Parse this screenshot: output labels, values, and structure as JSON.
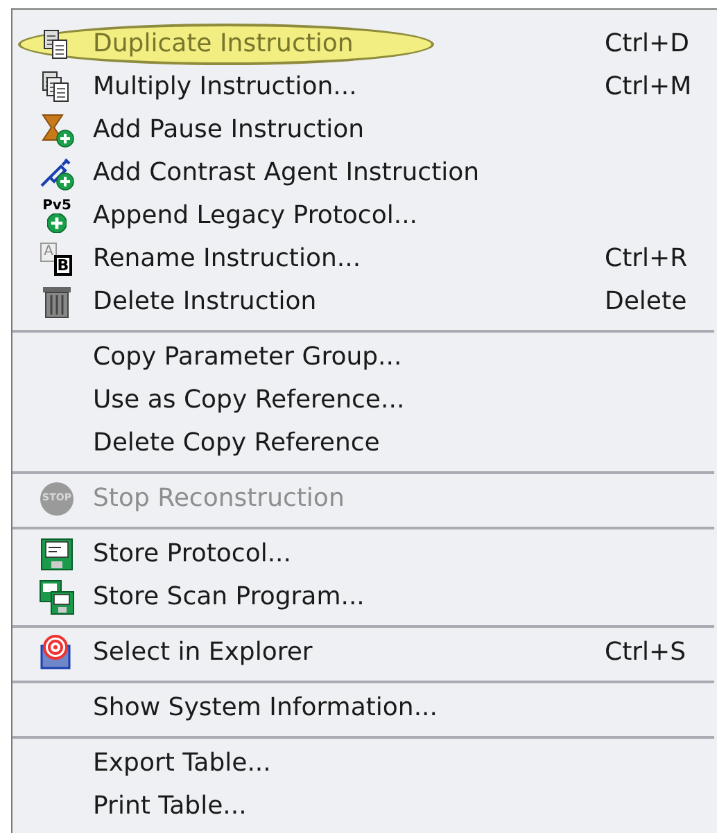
{
  "menu": {
    "sections": [
      {
        "items": [
          {
            "label": "Duplicate Instruction",
            "shortcut": "Ctrl+D",
            "kind": "copy",
            "disabled": false,
            "highlighted": true
          },
          {
            "label": "Multiply Instruction...",
            "shortcut": "Ctrl+M",
            "kind": "multi-copy",
            "disabled": false,
            "highlighted": false
          },
          {
            "label": "Add Pause Instruction",
            "kind": "hourglass-add",
            "disabled": false,
            "highlighted": false
          },
          {
            "label": "Add Contrast Agent Instruction",
            "kind": "syringe-add",
            "disabled": false,
            "highlighted": false
          },
          {
            "label": "Append Legacy Protocol...",
            "kind": "text-add",
            "icon_text": "Pv5",
            "disabled": false,
            "highlighted": false
          },
          {
            "label": "Rename Instruction...",
            "shortcut": "Ctrl+R",
            "kind": "rename",
            "icon_letters": [
              "A",
              "B"
            ],
            "disabled": false,
            "highlighted": false
          },
          {
            "label": "Delete Instruction",
            "shortcut": "Delete",
            "kind": "trash",
            "disabled": false,
            "highlighted": false
          }
        ]
      },
      {
        "items": [
          {
            "label": "Copy Parameter Group...",
            "disabled": false,
            "highlighted": false
          },
          {
            "label": "Use as Copy Reference...",
            "disabled": false,
            "highlighted": false
          },
          {
            "label": "Delete Copy Reference",
            "disabled": false,
            "highlighted": false
          }
        ]
      },
      {
        "items": [
          {
            "label": "Stop Reconstruction",
            "kind": "stop",
            "icon_text": "STOP",
            "disabled": true,
            "highlighted": false
          }
        ]
      },
      {
        "items": [
          {
            "label": "Store Protocol...",
            "kind": "floppy",
            "disabled": false,
            "highlighted": false
          },
          {
            "label": "Store Scan Program...",
            "kind": "floppies",
            "disabled": false,
            "highlighted": false
          }
        ]
      },
      {
        "items": [
          {
            "label": "Select in Explorer",
            "shortcut": "Ctrl+S",
            "kind": "target",
            "disabled": false,
            "highlighted": false
          }
        ]
      },
      {
        "items": [
          {
            "label": "Show System Information...",
            "disabled": false,
            "highlighted": false
          }
        ]
      },
      {
        "items": [
          {
            "label": "Export Table...",
            "disabled": false,
            "highlighted": false
          },
          {
            "label": "Print Table...",
            "disabled": false,
            "highlighted": false
          }
        ]
      }
    ]
  }
}
